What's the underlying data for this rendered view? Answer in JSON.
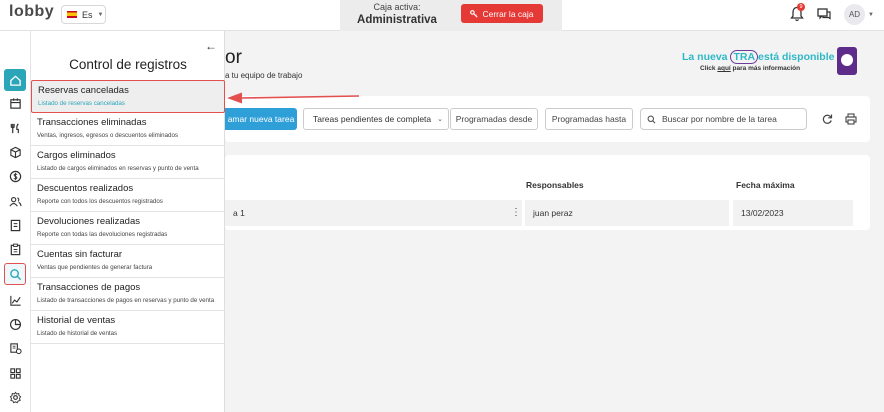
{
  "topbar": {
    "logo": "lobby",
    "language": "Es",
    "caja_label": "Caja activa:",
    "caja_value": "Administrativa",
    "close_button": "Cerrar la caja",
    "notification_count": "9",
    "avatar_initials": "AD"
  },
  "rail": {
    "icons": [
      "home-icon",
      "calendar-icon",
      "restaurant-icon",
      "box-icon",
      "dollar-icon",
      "users-icon",
      "book-icon",
      "clipboard-icon",
      "search-icon",
      "chart-line-icon",
      "pie-chart-icon",
      "cash-register-icon",
      "grid-icon",
      "settings-icon"
    ]
  },
  "drawer": {
    "title": "Control de registros",
    "items": [
      {
        "label": "Reservas canceladas",
        "desc": "Listado de reservas canceladas"
      },
      {
        "label": "Transacciones eliminadas",
        "desc": "Ventas, ingresos, egresos o descuentos eliminados"
      },
      {
        "label": "Cargos eliminados",
        "desc": "Listado de cargos eliminados en reservas y punto de venta"
      },
      {
        "label": "Descuentos realizados",
        "desc": "Reporte con todos los descuentos registrados"
      },
      {
        "label": "Devoluciones realizadas",
        "desc": "Reporte con todas las devoluciones registradas"
      },
      {
        "label": "Cuentas sin facturar",
        "desc": "Ventas que pendientes de generar factura"
      },
      {
        "label": "Transacciones de pagos",
        "desc": "Listado de transacciones de pagos en reservas y punto de venta"
      },
      {
        "label": "Historial de ventas",
        "desc": "Listado de historial de ventas"
      }
    ]
  },
  "main": {
    "title_fragment": "or",
    "subtitle_fragment": "a tu equipo de trabajo",
    "promo": {
      "prefix": "La nueva",
      "tra": "TRA",
      "suffix": "está disponible",
      "line2_a": "Click",
      "line2_b": "aquí",
      "line2_c": "para",
      "line2_d": "más información"
    },
    "toolbar": {
      "new_task": "amar nueva tarea",
      "filter_value": "Tareas pendientes de completa",
      "date_from": "Programadas desde",
      "date_to": "Programadas hasta",
      "search_placeholder": "Buscar por nombre de la tarea"
    },
    "table": {
      "headers": [
        "Responsables",
        "Fecha máxima"
      ],
      "rows": [
        {
          "task": "a 1",
          "responsible": "juan peraz",
          "date": "13/02/2023"
        }
      ]
    }
  },
  "colors": {
    "accent": "#2aa6b8",
    "danger": "#e53935",
    "primary_button": "#2f9fd8",
    "highlight_border": "#e25050"
  }
}
